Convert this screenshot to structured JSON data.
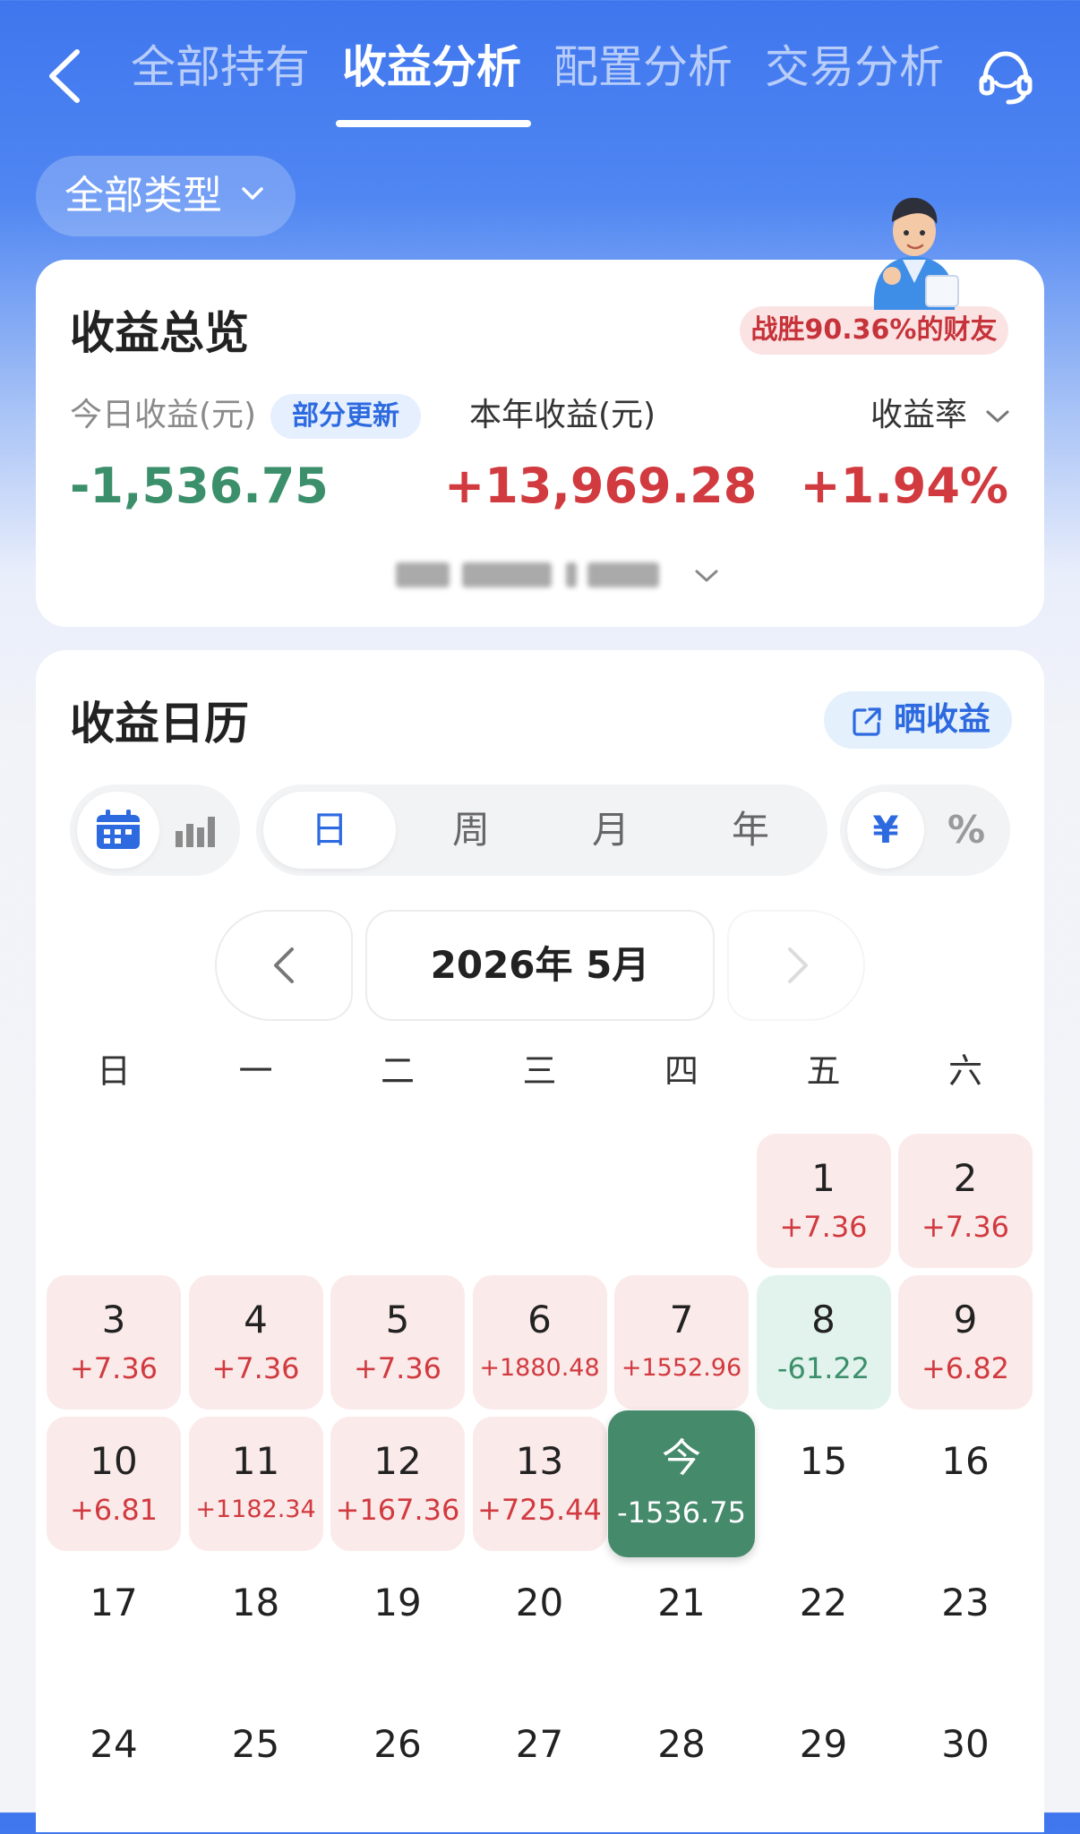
{
  "nav": {
    "tabs": [
      "全部持有",
      "收益分析",
      "配置分析",
      "交易分析"
    ],
    "active_tab": "收益分析"
  },
  "filter": {
    "type_label": "全部类型"
  },
  "overview": {
    "title": "收益总览",
    "beat_badge": "战胜90.36%的财友",
    "today_label": "今日收益(元)",
    "update_badge": "部分更新",
    "today_value": "-1,536.75",
    "year_label": "本年收益(元)",
    "year_value": "+13,969.28",
    "rate_label": "收益率",
    "rate_value": "+1.94%"
  },
  "calendar": {
    "title": "收益日历",
    "share_label": "晒收益",
    "period_tabs": [
      "日",
      "周",
      "月",
      "年"
    ],
    "active_period": "日",
    "unit_toggle": [
      "¥",
      "%"
    ],
    "active_unit": "¥",
    "month_label": "2026年 5月",
    "weekdays": [
      "日",
      "一",
      "二",
      "三",
      "四",
      "五",
      "六"
    ],
    "days": [
      {
        "n": "1",
        "chg": "+7.36",
        "kind": "pos"
      },
      {
        "n": "2",
        "chg": "+7.36",
        "kind": "pos"
      },
      {
        "n": "3",
        "chg": "+7.36",
        "kind": "pos"
      },
      {
        "n": "4",
        "chg": "+7.36",
        "kind": "pos"
      },
      {
        "n": "5",
        "chg": "+7.36",
        "kind": "pos"
      },
      {
        "n": "6",
        "chg": "+1880.48",
        "kind": "pos"
      },
      {
        "n": "7",
        "chg": "+1552.96",
        "kind": "pos"
      },
      {
        "n": "8",
        "chg": "-61.22",
        "kind": "neg"
      },
      {
        "n": "9",
        "chg": "+6.82",
        "kind": "pos"
      },
      {
        "n": "10",
        "chg": "+6.81",
        "kind": "pos"
      },
      {
        "n": "11",
        "chg": "+1182.34",
        "kind": "pos"
      },
      {
        "n": "12",
        "chg": "+167.36",
        "kind": "pos"
      },
      {
        "n": "13",
        "chg": "+725.44",
        "kind": "pos"
      },
      {
        "n": "今",
        "chg": "-1536.75",
        "kind": "today"
      },
      {
        "n": "15",
        "chg": "",
        "kind": "none"
      },
      {
        "n": "16",
        "chg": "",
        "kind": "none"
      },
      {
        "n": "17",
        "chg": "",
        "kind": "none"
      },
      {
        "n": "18",
        "chg": "",
        "kind": "none"
      },
      {
        "n": "19",
        "chg": "",
        "kind": "none"
      },
      {
        "n": "20",
        "chg": "",
        "kind": "none"
      },
      {
        "n": "21",
        "chg": "",
        "kind": "none"
      },
      {
        "n": "22",
        "chg": "",
        "kind": "none"
      },
      {
        "n": "23",
        "chg": "",
        "kind": "none"
      },
      {
        "n": "24",
        "chg": "",
        "kind": "none"
      },
      {
        "n": "25",
        "chg": "",
        "kind": "none"
      },
      {
        "n": "26",
        "chg": "",
        "kind": "none"
      },
      {
        "n": "27",
        "chg": "",
        "kind": "none"
      },
      {
        "n": "28",
        "chg": "",
        "kind": "none"
      },
      {
        "n": "29",
        "chg": "",
        "kind": "none"
      },
      {
        "n": "30",
        "chg": "",
        "kind": "none"
      }
    ],
    "first_weekday_index": 5
  },
  "icons": {
    "back": "chevron-left-icon",
    "support": "headset-icon",
    "calendar_view": "calendar-icon",
    "chart_view": "bar-chart-icon",
    "share": "share-icon"
  },
  "colors": {
    "brand_blue": "#3f76ee",
    "gain_red": "#d13a3f",
    "loss_green": "#3c8f6b",
    "today_green": "#468a6c"
  }
}
